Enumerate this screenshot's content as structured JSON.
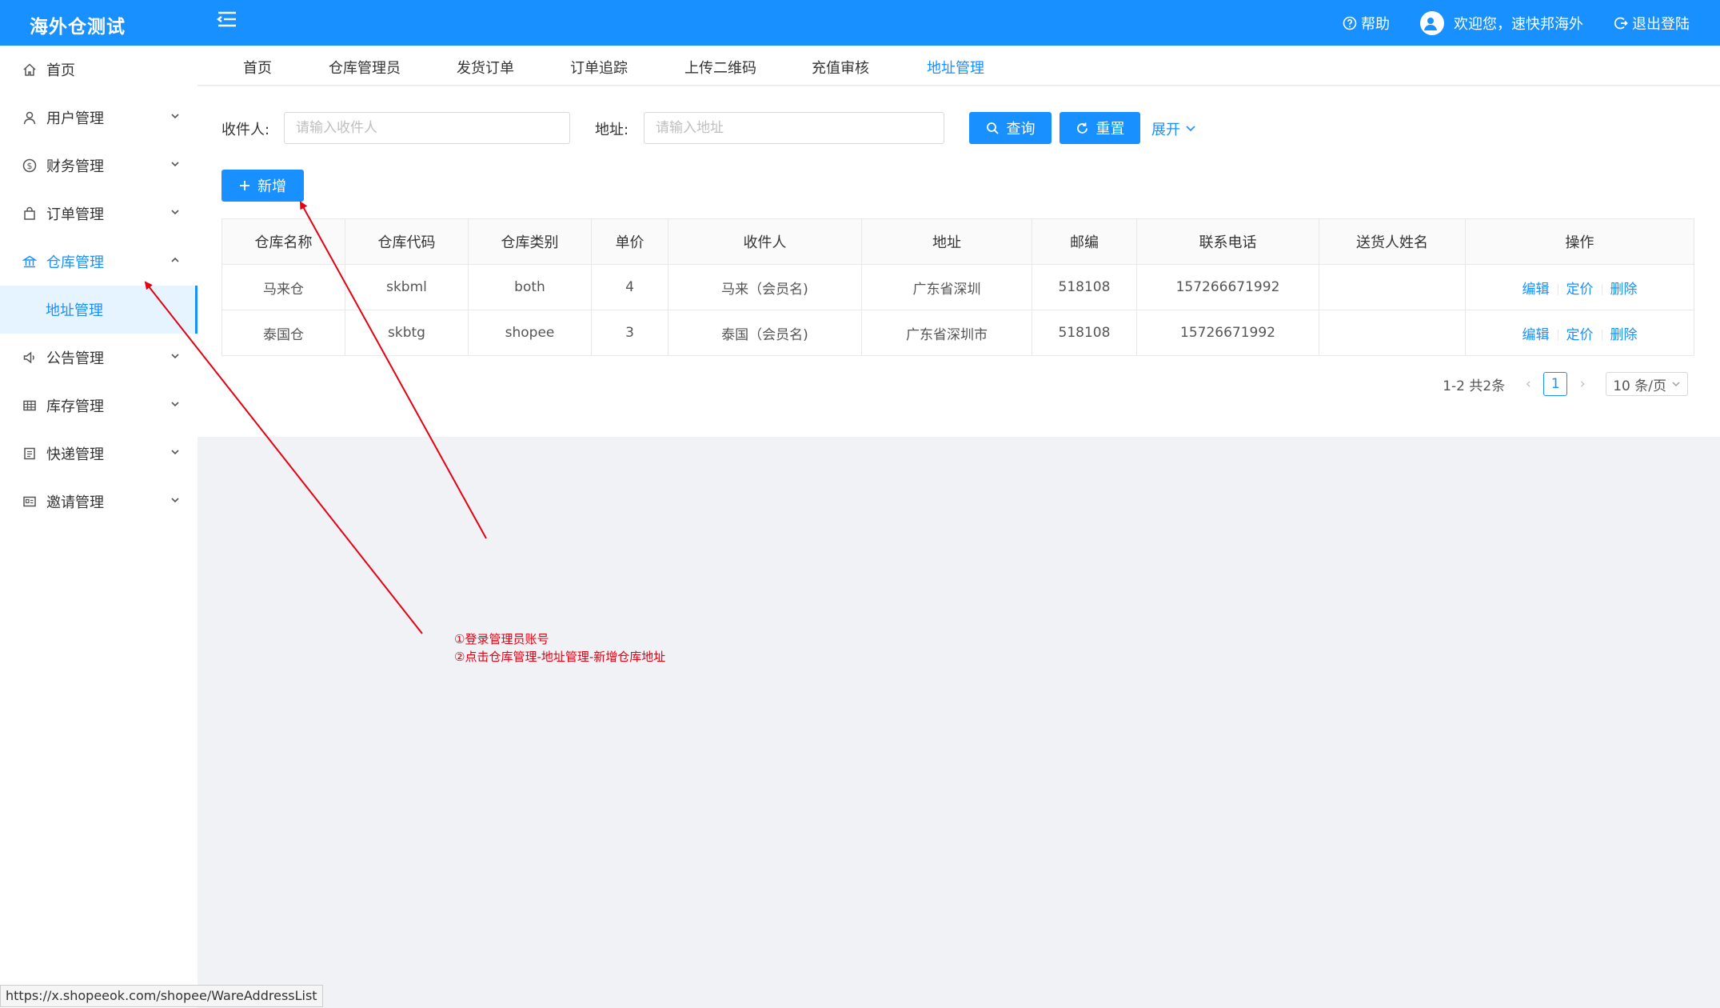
{
  "header": {
    "logo": "海外仓测试",
    "help": "帮助",
    "welcome": "欢迎您，速快邦海外",
    "logout": "退出登陆",
    "color": "#1890ff"
  },
  "sidebar": {
    "items": [
      {
        "label": "首页",
        "icon": "home-icon"
      },
      {
        "label": "用户管理",
        "icon": "user-icon"
      },
      {
        "label": "财务管理",
        "icon": "dollar-icon"
      },
      {
        "label": "订单管理",
        "icon": "bag-icon"
      },
      {
        "label": "仓库管理",
        "icon": "bank-icon"
      },
      {
        "label": "地址管理"
      },
      {
        "label": "公告管理",
        "icon": "sound-icon"
      },
      {
        "label": "库存管理",
        "icon": "table-icon"
      },
      {
        "label": "快递管理",
        "icon": "profile-icon"
      },
      {
        "label": "邀请管理",
        "icon": "idcard-icon"
      }
    ]
  },
  "tabs": [
    "首页",
    "仓库管理员",
    "发货订单",
    "订单追踪",
    "上传二维码",
    "充值审核",
    "地址管理"
  ],
  "search": {
    "receiver_label": "收件人:",
    "receiver_placeholder": "请输入收件人",
    "address_label": "地址:",
    "address_placeholder": "请输入地址",
    "query": "查询",
    "reset": "重置",
    "expand": "展开",
    "add": "新增"
  },
  "table": {
    "columns": [
      "仓库名称",
      "仓库代码",
      "仓库类别",
      "单价",
      "收件人",
      "地址",
      "邮编",
      "联系电话",
      "送货人姓名",
      "操作"
    ],
    "rows": [
      [
        "马来仓",
        "skbml",
        "both",
        "4",
        "马来（会员名)",
        "广东省深圳",
        "518108",
        "157266671992",
        ""
      ],
      [
        "泰国仓",
        "skbtg",
        "shopee",
        "3",
        "泰国（会员名)",
        "广东省深圳市",
        "518108",
        "15726671992",
        ""
      ]
    ],
    "ops": [
      "编辑",
      "定价",
      "删除"
    ]
  },
  "pager": {
    "total": "1-2 共2条",
    "current": "1",
    "size": "10 条/页"
  },
  "annotation": {
    "line1": "①登录管理员账号",
    "line2": "②点击仓库管理-地址管理-新增仓库地址"
  },
  "statusbar": "https://x.shopeeok.com/shopee/WareAddressList"
}
